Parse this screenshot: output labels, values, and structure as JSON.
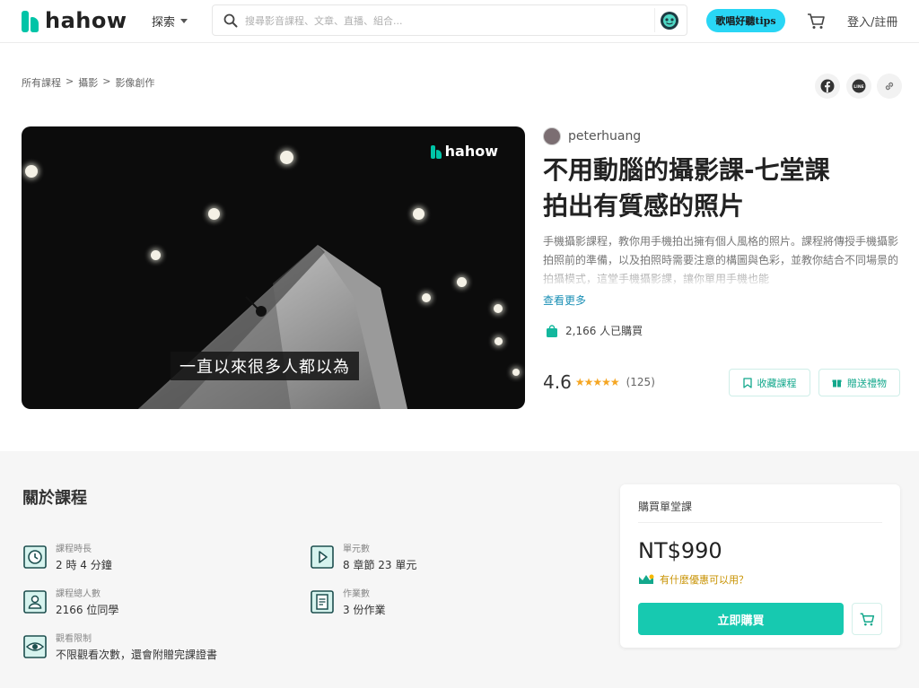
{
  "header": {
    "logo_text": "hahow",
    "explore_label": "探索",
    "search_placeholder": "搜尋影音課程、文章、直播、組合...",
    "promo_label": "歌唱好聽tips",
    "login_label": "登入/註冊"
  },
  "breadcrumb": [
    "所有課程",
    ">",
    "攝影",
    ">",
    "影像創作"
  ],
  "share_icons": [
    "facebook-icon",
    "line-icon",
    "link-icon"
  ],
  "hero": {
    "logo_text": "hahow",
    "caption": "一直以來很多人都以為"
  },
  "course": {
    "author": "peterhuang",
    "title_line1": "不用動腦的攝影課-七堂課",
    "title_line2": "拍出有質感的照片",
    "description": "手機攝影課程，教你用手機拍出擁有個人風格的照片。課程將傳授手機攝影拍照前的準備，以及拍照時需要注意的構圖與色彩，並教你結合不同場景的拍攝模式，這堂手機攝影課，讓你單用手機也能",
    "more_label": "查看更多",
    "sold_text": "2,166 人已購買",
    "rating_score": "4.6",
    "rating_stars": 4.6,
    "rating_count": "(125)",
    "favorite_label": "收藏課程",
    "gift_label": "贈送禮物"
  },
  "about": {
    "title": "關於課程",
    "stats": [
      {
        "label": "課程時長",
        "value": "2 時 4 分鐘",
        "icon": "clock-icon"
      },
      {
        "label": "單元數",
        "value": "8 章節 23 單元",
        "icon": "play-icon"
      },
      {
        "label": "課程總人數",
        "value": "2166 位同學",
        "icon": "people-icon"
      },
      {
        "label": "作業數",
        "value": "3 份作業",
        "icon": "document-icon"
      },
      {
        "label": "觀看限制",
        "value": "不限觀看次數，還會附贈完課證書",
        "icon": "eye-icon"
      }
    ]
  },
  "purchase": {
    "heading": "購買單堂課",
    "price": "NT$990",
    "coupon_text": "有什麼優惠可以用？",
    "buy_label": "立即購買"
  },
  "colors": {
    "brand": "#00c4a7",
    "button": "#17c9b0",
    "link": "#1a8fb5",
    "coupon": "#c89200",
    "star": "#f5a623"
  }
}
